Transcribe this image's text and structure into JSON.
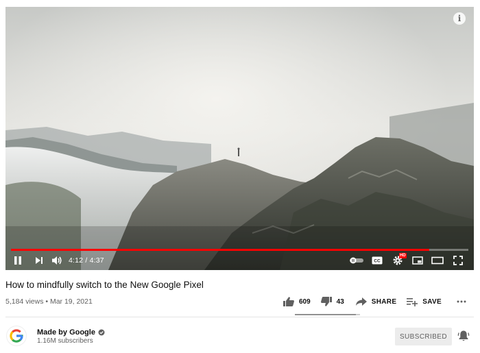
{
  "player": {
    "info_icon": "info-icon",
    "progress_fraction": 0.9142,
    "current_time": "4:12",
    "duration": "4:37",
    "time_text": "4:12 / 4:37",
    "hd_badge": "HD",
    "cc_label": "CC",
    "accent_color": "#ff0000",
    "icons": [
      "pause-icon",
      "next-icon",
      "volume-icon",
      "autoplay-toggle-icon",
      "captions-icon",
      "settings-icon",
      "miniplayer-icon",
      "theater-mode-icon",
      "fullscreen-icon"
    ]
  },
  "video": {
    "title": "How to mindfully switch to the New Google Pixel",
    "meta": "5,184 views • Mar 19, 2021",
    "likes": "609",
    "dislikes": "43",
    "share_label": "SHARE",
    "save_label": "SAVE",
    "like_fraction": 0.934
  },
  "channel": {
    "name": "Made by Google",
    "subscribers": "1.16M subscribers",
    "subscribe_label": "SUBSCRIBED",
    "verified_icon": "verified-check-icon",
    "bell_icon": "notification-bell-icon"
  }
}
